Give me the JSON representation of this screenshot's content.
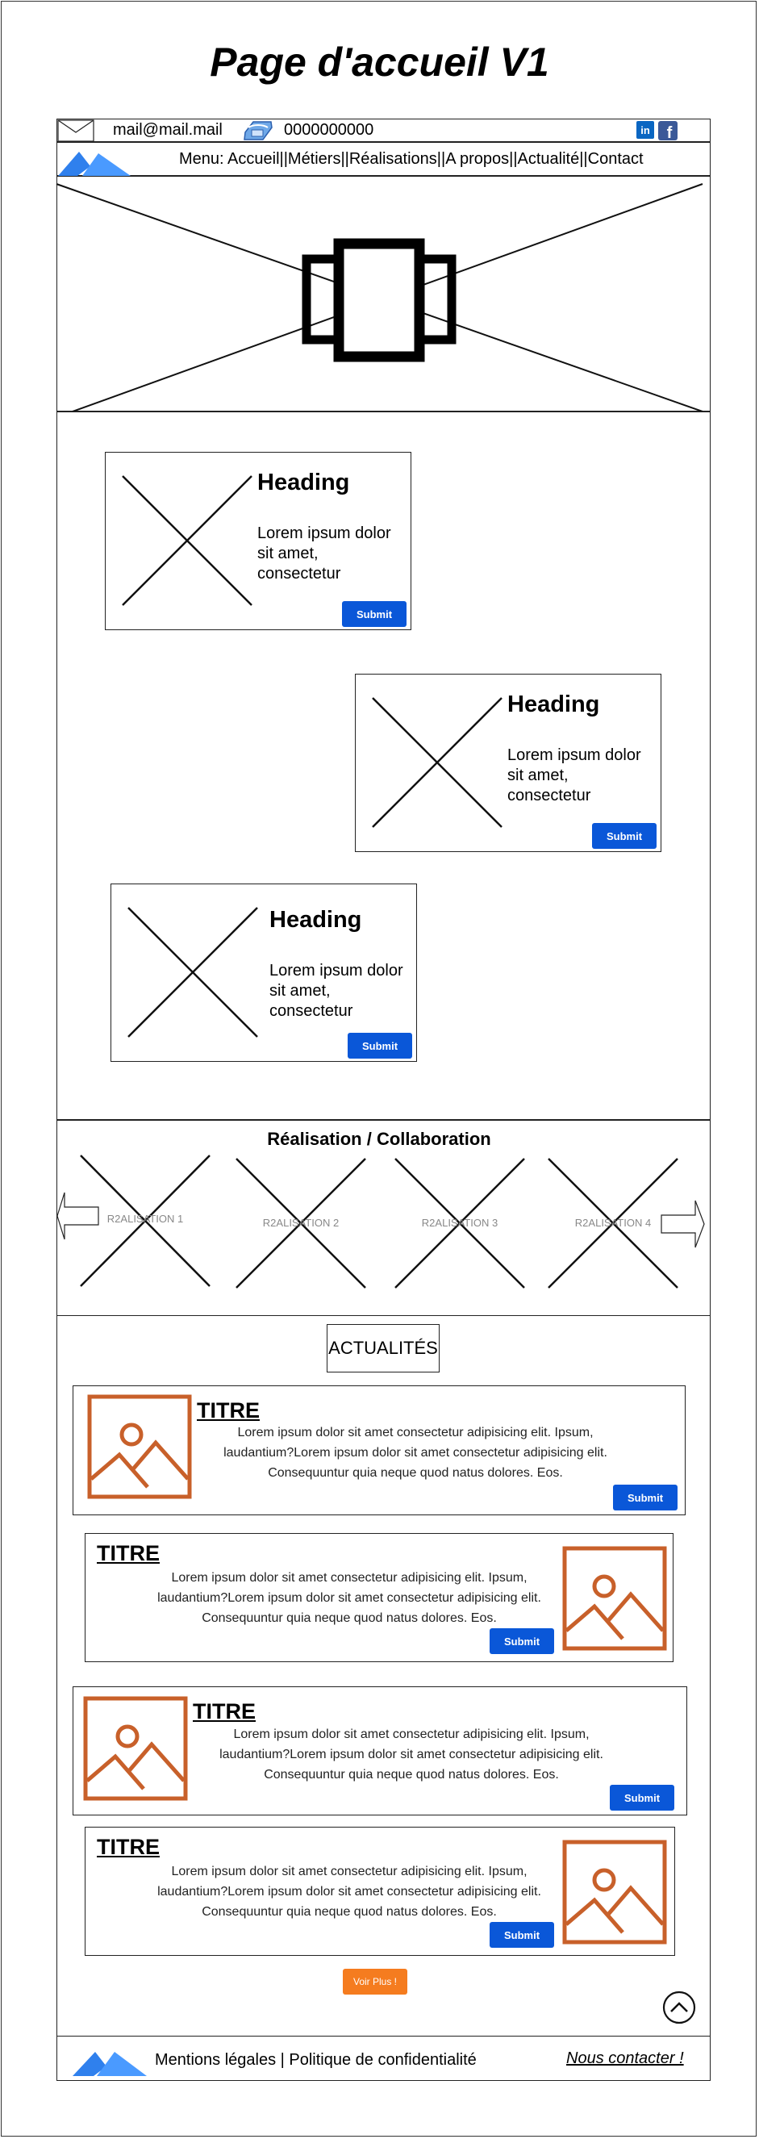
{
  "page_title": "Page d'accueil V1",
  "topbar": {
    "email": "mail@mail.mail",
    "phone": "0000000000"
  },
  "nav": {
    "menu_text": "Menu: Accueil||Métiers||Réalisations||A propos||Actualité||Contact"
  },
  "cards": [
    {
      "heading": "Heading",
      "text_lines": [
        "Lorem ipsum dolor",
        "sit amet,",
        "consectetur"
      ],
      "button": "Submit"
    },
    {
      "heading": "Heading",
      "text_lines": [
        "Lorem ipsum dolor",
        "sit amet,",
        "consectetur"
      ],
      "button": "Submit"
    },
    {
      "heading": "Heading",
      "text_lines": [
        "Lorem ipsum dolor",
        "sit amet,",
        "consectetur"
      ],
      "button": "Submit"
    }
  ],
  "realisation": {
    "title": "Réalisation / Collaboration",
    "items": [
      "R2ALISATION 1",
      "R2ALISATION 2",
      "R2ALISATION 3",
      "R2ALISATION 4"
    ]
  },
  "news": {
    "section_title": "ACTUALITÉS",
    "items": [
      {
        "title": "TITRE",
        "lines": [
          "Lorem ipsum dolor sit amet consectetur adipisicing elit. Ipsum,",
          "laudantium?Lorem ipsum dolor sit amet consectetur adipisicing elit.",
          "Consequuntur quia neque quod natus dolores. Eos."
        ],
        "button": "Submit"
      },
      {
        "title": "TITRE",
        "lines": [
          "Lorem ipsum dolor sit amet consectetur adipisicing elit. Ipsum,",
          "laudantium?Lorem ipsum dolor sit amet consectetur adipisicing elit.",
          "Consequuntur quia neque quod natus dolores. Eos."
        ],
        "button": "Submit"
      },
      {
        "title": "TITRE",
        "lines": [
          "Lorem ipsum dolor sit amet consectetur adipisicing elit. Ipsum,",
          "laudantium?Lorem ipsum dolor sit amet consectetur adipisicing elit.",
          "Consequuntur quia neque quod natus dolores. Eos."
        ],
        "button": "Submit"
      },
      {
        "title": "TITRE",
        "lines": [
          "Lorem ipsum dolor sit amet consectetur adipisicing elit. Ipsum,",
          "laudantium?Lorem ipsum dolor sit amet consectetur adipisicing elit.",
          "Consequuntur quia neque quod natus dolores. Eos."
        ],
        "button": "Submit"
      }
    ],
    "more_button": "Voir Plus !"
  },
  "footer": {
    "links": "Mentions légales | Politique de confidentialité",
    "contact": "Nous contacter !"
  },
  "icons": {
    "mail": "mail-icon",
    "phone": "phone-icon",
    "linkedin": "linkedin-icon",
    "facebook": "facebook-icon",
    "logo": "logo-icon",
    "carousel": "carousel-icon",
    "image_placeholder": "image-placeholder-icon",
    "arrow_left": "arrow-left-icon",
    "arrow_right": "arrow-right-icon",
    "scroll_top": "scroll-top-icon"
  },
  "colors": {
    "button_blue": "#0a57d8",
    "logo_blue": "#2f80ed",
    "image_orange": "#c8602a",
    "more_button_orange": "#f57c1f",
    "linkedin_blue": "#0a66c2",
    "facebook_blue": "#3b5998"
  }
}
